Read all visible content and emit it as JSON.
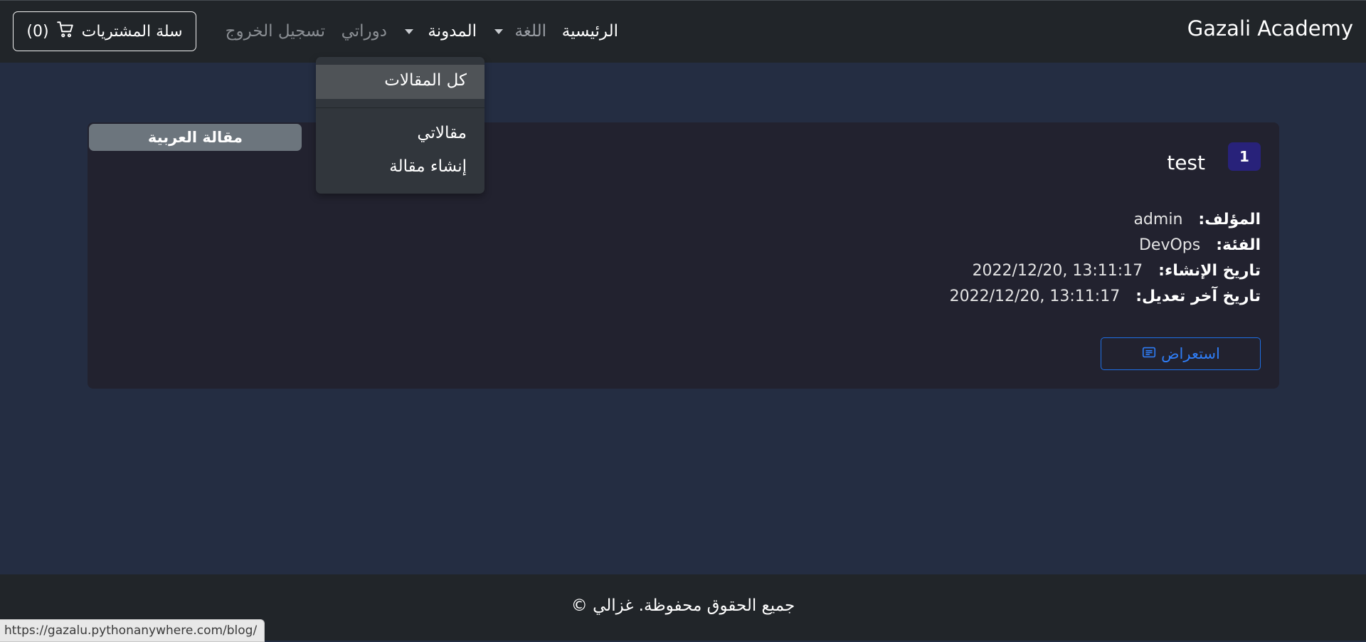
{
  "navbar": {
    "brand": "Gazali Academy",
    "home": "الرئيسية",
    "language": "اللغة",
    "blog": "المدونة",
    "my_courses": "دوراتي",
    "logout": "تسجيل الخروج",
    "cart_label": "سلة المشتريات",
    "cart_count": "(0)"
  },
  "blog_dropdown": {
    "items": [
      "كل المقالات",
      "مقالاتي",
      "إنشاء مقالة"
    ]
  },
  "article": {
    "language_badge": "مقالة العربية",
    "number": "1",
    "title": "test",
    "author_label": "المؤلف:",
    "author": "admin",
    "category_label": "الفئة:",
    "category": "DevOps",
    "created_label": "تاريخ الإنشاء:",
    "created": "2022/12/20, 13:11:17",
    "modified_label": "تاريخ آخر تعديل:",
    "modified": "2022/12/20, 13:11:17",
    "view_button": "استعراض"
  },
  "footer": {
    "copyright": "جميع الحقوق محفوظة. غزالي ©"
  },
  "status_bar": {
    "url": "https://gazalu.pythonanywhere.com/blog/"
  },
  "colors": {
    "navbar_bg": "#212529",
    "page_bg": "#242d42",
    "card_bg": "#22222f",
    "badge_secondary": "#6c757d",
    "badge_number": "#28227a",
    "accent_blue": "#2f7df6"
  },
  "icons": {
    "cart": "cart-icon",
    "view": "article-icon"
  }
}
